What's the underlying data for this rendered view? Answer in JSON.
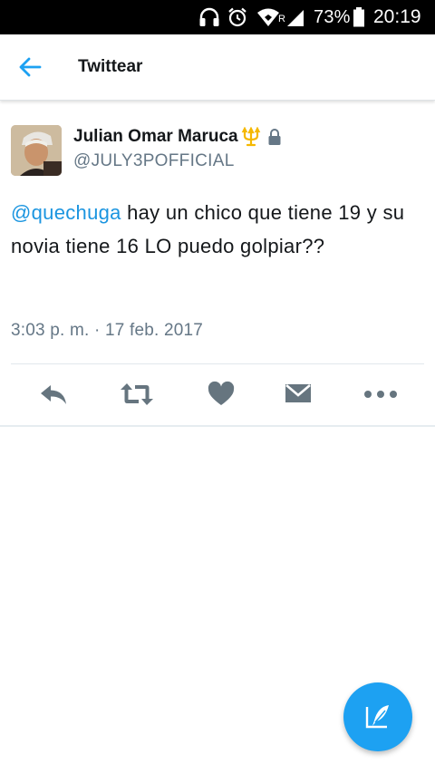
{
  "status_bar": {
    "battery_percent": "73%",
    "time": "20:19",
    "network_label": "R"
  },
  "header": {
    "title": "Twittear"
  },
  "tweet": {
    "display_name": "Julian Omar Maruca",
    "handle": "@JULY3POFFICIAL",
    "mention": "@quechuga",
    "text_after_mention": " hay un chico que tiene 19 y su novia tiene 16 LO puedo golpiar??",
    "timestamp": "3:03 p. m. · 17 feb. 2017"
  },
  "actions": [
    "reply-icon",
    "retweet-icon",
    "like-icon",
    "dm-icon",
    "more-icon"
  ],
  "colors": {
    "accent": "#1da1f2",
    "mention": "#1b95e0",
    "secondary_text": "#657786",
    "icon_gray": "#66757f",
    "trident": "#f5b800"
  }
}
